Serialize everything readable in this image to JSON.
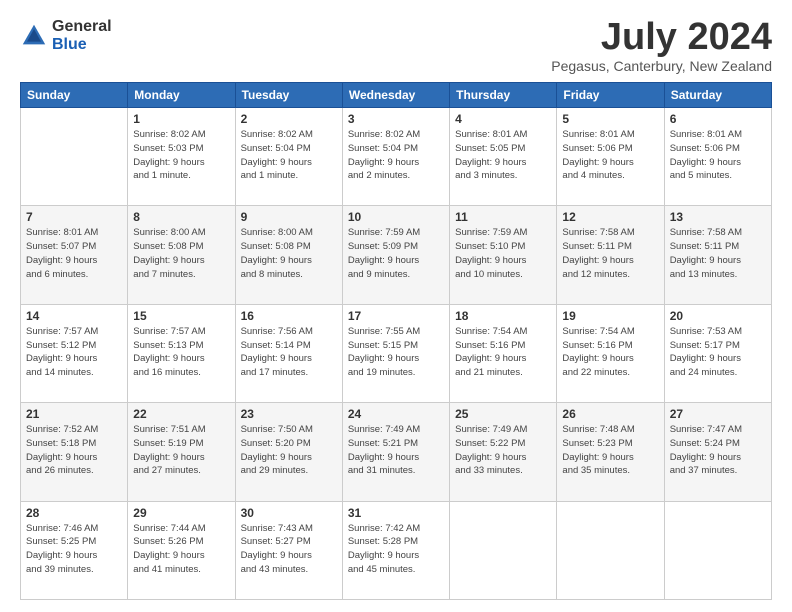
{
  "logo": {
    "general": "General",
    "blue": "Blue"
  },
  "header": {
    "month": "July 2024",
    "location": "Pegasus, Canterbury, New Zealand"
  },
  "weekdays": [
    "Sunday",
    "Monday",
    "Tuesday",
    "Wednesday",
    "Thursday",
    "Friday",
    "Saturday"
  ],
  "weeks": [
    [
      {
        "day": "",
        "info": ""
      },
      {
        "day": "1",
        "info": "Sunrise: 8:02 AM\nSunset: 5:03 PM\nDaylight: 9 hours\nand 1 minute."
      },
      {
        "day": "2",
        "info": "Sunrise: 8:02 AM\nSunset: 5:04 PM\nDaylight: 9 hours\nand 1 minute."
      },
      {
        "day": "3",
        "info": "Sunrise: 8:02 AM\nSunset: 5:04 PM\nDaylight: 9 hours\nand 2 minutes."
      },
      {
        "day": "4",
        "info": "Sunrise: 8:01 AM\nSunset: 5:05 PM\nDaylight: 9 hours\nand 3 minutes."
      },
      {
        "day": "5",
        "info": "Sunrise: 8:01 AM\nSunset: 5:06 PM\nDaylight: 9 hours\nand 4 minutes."
      },
      {
        "day": "6",
        "info": "Sunrise: 8:01 AM\nSunset: 5:06 PM\nDaylight: 9 hours\nand 5 minutes."
      }
    ],
    [
      {
        "day": "7",
        "info": "Sunrise: 8:01 AM\nSunset: 5:07 PM\nDaylight: 9 hours\nand 6 minutes."
      },
      {
        "day": "8",
        "info": "Sunrise: 8:00 AM\nSunset: 5:08 PM\nDaylight: 9 hours\nand 7 minutes."
      },
      {
        "day": "9",
        "info": "Sunrise: 8:00 AM\nSunset: 5:08 PM\nDaylight: 9 hours\nand 8 minutes."
      },
      {
        "day": "10",
        "info": "Sunrise: 7:59 AM\nSunset: 5:09 PM\nDaylight: 9 hours\nand 9 minutes."
      },
      {
        "day": "11",
        "info": "Sunrise: 7:59 AM\nSunset: 5:10 PM\nDaylight: 9 hours\nand 10 minutes."
      },
      {
        "day": "12",
        "info": "Sunrise: 7:58 AM\nSunset: 5:11 PM\nDaylight: 9 hours\nand 12 minutes."
      },
      {
        "day": "13",
        "info": "Sunrise: 7:58 AM\nSunset: 5:11 PM\nDaylight: 9 hours\nand 13 minutes."
      }
    ],
    [
      {
        "day": "14",
        "info": "Sunrise: 7:57 AM\nSunset: 5:12 PM\nDaylight: 9 hours\nand 14 minutes."
      },
      {
        "day": "15",
        "info": "Sunrise: 7:57 AM\nSunset: 5:13 PM\nDaylight: 9 hours\nand 16 minutes."
      },
      {
        "day": "16",
        "info": "Sunrise: 7:56 AM\nSunset: 5:14 PM\nDaylight: 9 hours\nand 17 minutes."
      },
      {
        "day": "17",
        "info": "Sunrise: 7:55 AM\nSunset: 5:15 PM\nDaylight: 9 hours\nand 19 minutes."
      },
      {
        "day": "18",
        "info": "Sunrise: 7:54 AM\nSunset: 5:16 PM\nDaylight: 9 hours\nand 21 minutes."
      },
      {
        "day": "19",
        "info": "Sunrise: 7:54 AM\nSunset: 5:16 PM\nDaylight: 9 hours\nand 22 minutes."
      },
      {
        "day": "20",
        "info": "Sunrise: 7:53 AM\nSunset: 5:17 PM\nDaylight: 9 hours\nand 24 minutes."
      }
    ],
    [
      {
        "day": "21",
        "info": "Sunrise: 7:52 AM\nSunset: 5:18 PM\nDaylight: 9 hours\nand 26 minutes."
      },
      {
        "day": "22",
        "info": "Sunrise: 7:51 AM\nSunset: 5:19 PM\nDaylight: 9 hours\nand 27 minutes."
      },
      {
        "day": "23",
        "info": "Sunrise: 7:50 AM\nSunset: 5:20 PM\nDaylight: 9 hours\nand 29 minutes."
      },
      {
        "day": "24",
        "info": "Sunrise: 7:49 AM\nSunset: 5:21 PM\nDaylight: 9 hours\nand 31 minutes."
      },
      {
        "day": "25",
        "info": "Sunrise: 7:49 AM\nSunset: 5:22 PM\nDaylight: 9 hours\nand 33 minutes."
      },
      {
        "day": "26",
        "info": "Sunrise: 7:48 AM\nSunset: 5:23 PM\nDaylight: 9 hours\nand 35 minutes."
      },
      {
        "day": "27",
        "info": "Sunrise: 7:47 AM\nSunset: 5:24 PM\nDaylight: 9 hours\nand 37 minutes."
      }
    ],
    [
      {
        "day": "28",
        "info": "Sunrise: 7:46 AM\nSunset: 5:25 PM\nDaylight: 9 hours\nand 39 minutes."
      },
      {
        "day": "29",
        "info": "Sunrise: 7:44 AM\nSunset: 5:26 PM\nDaylight: 9 hours\nand 41 minutes."
      },
      {
        "day": "30",
        "info": "Sunrise: 7:43 AM\nSunset: 5:27 PM\nDaylight: 9 hours\nand 43 minutes."
      },
      {
        "day": "31",
        "info": "Sunrise: 7:42 AM\nSunset: 5:28 PM\nDaylight: 9 hours\nand 45 minutes."
      },
      {
        "day": "",
        "info": ""
      },
      {
        "day": "",
        "info": ""
      },
      {
        "day": "",
        "info": ""
      }
    ]
  ]
}
